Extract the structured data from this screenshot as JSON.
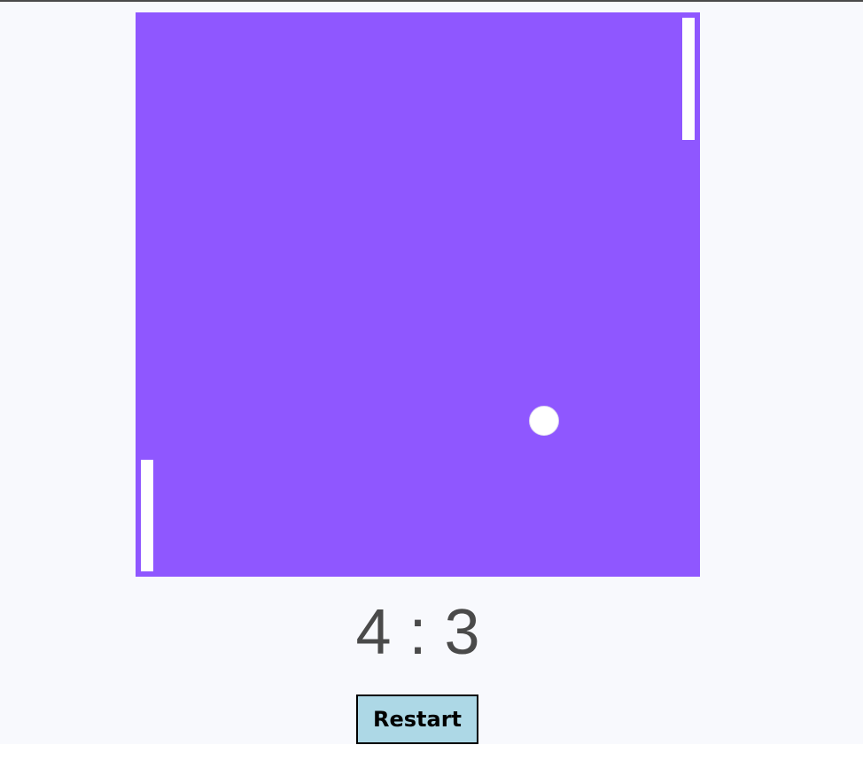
{
  "game": {
    "board_color": "#8f57ff",
    "paddle_color": "#ffffff",
    "ball_color": "#ffffff"
  },
  "score": {
    "left": "4",
    "separator": " : ",
    "right": "3"
  },
  "controls": {
    "restart_label": "Restart",
    "restart_color": "#add8e6"
  }
}
